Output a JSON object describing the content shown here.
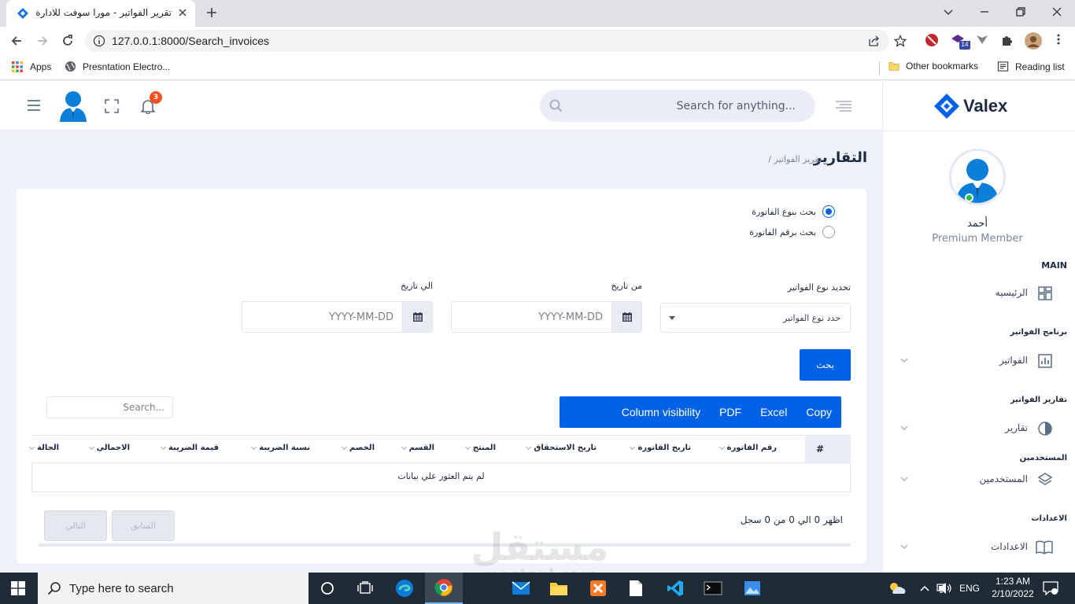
{
  "browser": {
    "tab_title": "تقرير الفواتير - مورا سوفت للادارة ال",
    "url": "127.0.0.1:8000/Search_invoices",
    "bookmarks": {
      "apps": "Apps",
      "item1": "Presntation Electro...",
      "other": "Other bookmarks",
      "reading": "Reading list"
    },
    "extension_badge": "14"
  },
  "header": {
    "search_placeholder": "Search for anything...",
    "notifications_count": "3"
  },
  "sidebar": {
    "brand": "Valex",
    "user_name": "أحمد",
    "user_role": "Premium Member",
    "main_label": "MAIN",
    "home": "الرئيسيه",
    "cat_invoices": "برنامج الفواتير",
    "invoices": "الفواتير",
    "cat_reports": "تقارير الفواتير",
    "reports": "تقارير",
    "cat_users": "المستخدمين",
    "users": "المستخدمين",
    "cat_settings": "الاعدادات",
    "settings": "الاعدادات"
  },
  "breadcrumb": {
    "title": "التقارير",
    "sub": "/ تقرير الفواتير"
  },
  "form": {
    "radio_type": "بحث بنوع الفاتورة",
    "radio_number": "بحث برقم الفاتورة",
    "type_label": "تحديد نوع الفواتير",
    "type_value": "حدد نوع الفواتير",
    "from_label": "من تاريخ",
    "to_label": "الي تاريخ",
    "date_placeholder": "YYYY-MM-DD",
    "search_button": "بحث"
  },
  "table": {
    "export_buttons": [
      "Copy",
      "Excel",
      "PDF",
      "Column visibility"
    ],
    "search_placeholder": "Search...",
    "hash": "#",
    "columns": {
      "invoice_number": "رقم الفاتورة",
      "invoice_date": "تاريخ القاتورة",
      "due_date": "تاريخ الاستحقاق",
      "product": "المنتج",
      "section": "القسم",
      "discount": "الخصم",
      "tax_rate": "نسبة الضريبة",
      "tax_value": "قيمة الضريبة",
      "total": "الاجمالي",
      "status": "الحالة"
    },
    "empty_text": "لم يتم العثور علي بيانات",
    "info_text": "اظهر 0 الي 0 من 0 سجل",
    "prev": "السابق",
    "next": "التالي"
  },
  "watermark": {
    "arabic": "مستقل",
    "latin": "mostaql.com"
  },
  "taskbar": {
    "search_placeholder": "Type here to search",
    "language": "ENG",
    "time": "1:23 AM",
    "date": "2/10/2022"
  }
}
